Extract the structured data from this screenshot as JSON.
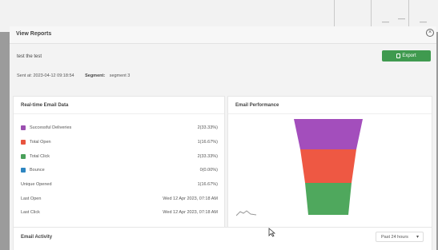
{
  "background": {
    "dash_1": "—",
    "dash_2": "—",
    "dash_3": "—"
  },
  "modal": {
    "title": "View Reports",
    "close_icon": "×"
  },
  "subject": "test the test",
  "export_label": "Export",
  "meta": {
    "sent_at": "Sent at: 2023-04-12 09:18:54",
    "segment_label": "Segment:",
    "segment_value": "segment 3"
  },
  "email_data": {
    "title": "Real-time Email Data",
    "rows": [
      {
        "label": "Successful Deliveries",
        "value": "2(33.33%)",
        "color": "#9b4fb0"
      },
      {
        "label": "Total Open",
        "value": "1(16.67%)",
        "color": "#e8543f"
      },
      {
        "label": "Total Click",
        "value": "2(33.33%)",
        "color": "#4aa05a"
      },
      {
        "label": "Bounce",
        "value": "0(0.00%)",
        "color": "#2e86c1"
      },
      {
        "label": "Unique Opened",
        "value": "1(16.67%)"
      },
      {
        "label": "Last Open",
        "value": "Wed 12 Apr 2023, 07:18 AM"
      },
      {
        "label": "Last Click",
        "value": "Wed 12 Apr 2023, 07:18 AM"
      }
    ]
  },
  "performance": {
    "title": "Email Performance",
    "colors": [
      "#a34ebc",
      "#ee5843",
      "#4fa85d"
    ]
  },
  "activity": {
    "title": "Email Activity",
    "range": "Past 24 hours",
    "chevron": "▾"
  }
}
